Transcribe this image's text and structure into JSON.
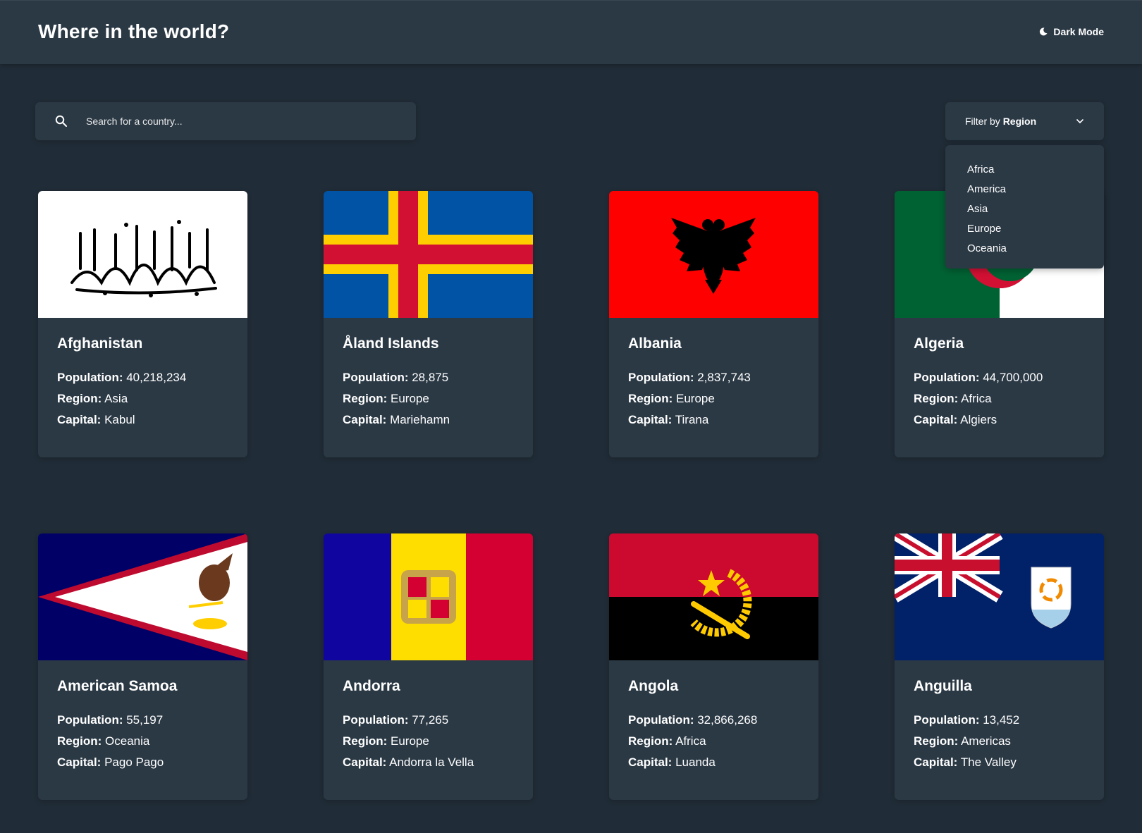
{
  "header": {
    "title": "Where in the world?",
    "theme_label": "Dark Mode"
  },
  "search": {
    "placeholder": "Search for a country..."
  },
  "filter": {
    "prefix": "Filter by ",
    "bold": "Region",
    "options": [
      "Africa",
      "America",
      "Asia",
      "Europe",
      "Oceania"
    ]
  },
  "labels": {
    "population": "Population:",
    "region": "Region:",
    "capital": "Capital:"
  },
  "countries": [
    {
      "name": "Afghanistan",
      "population": "40,218,234",
      "region": "Asia",
      "capital": "Kabul"
    },
    {
      "name": "Åland Islands",
      "population": "28,875",
      "region": "Europe",
      "capital": "Mariehamn"
    },
    {
      "name": "Albania",
      "population": "2,837,743",
      "region": "Europe",
      "capital": "Tirana"
    },
    {
      "name": "Algeria",
      "population": "44,700,000",
      "region": "Africa",
      "capital": "Algiers"
    },
    {
      "name": "American Samoa",
      "population": "55,197",
      "region": "Oceania",
      "capital": "Pago Pago"
    },
    {
      "name": "Andorra",
      "population": "77,265",
      "region": "Europe",
      "capital": "Andorra la Vella"
    },
    {
      "name": "Angola",
      "population": "32,866,268",
      "region": "Africa",
      "capital": "Luanda"
    },
    {
      "name": "Anguilla",
      "population": "13,452",
      "region": "Americas",
      "capital": "The Valley"
    }
  ],
  "colors": {
    "background": "#202c37",
    "element": "#2b3945",
    "text": "#ffffff"
  }
}
